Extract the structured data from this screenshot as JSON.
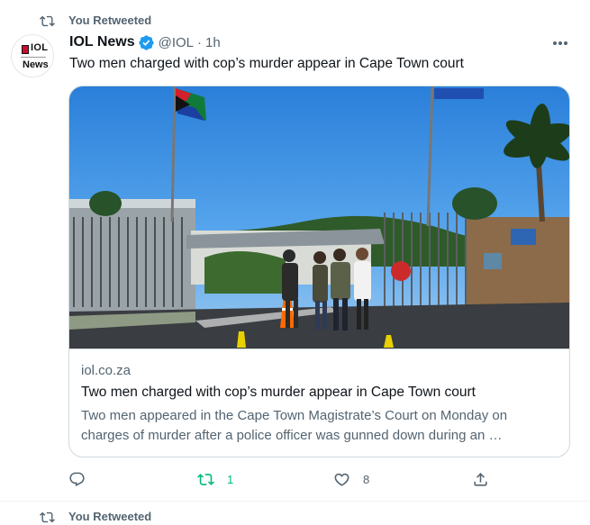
{
  "retweet_header": {
    "label": "You Retweeted"
  },
  "author": {
    "display_name": "IOL News",
    "handle": "@IOL",
    "separator": "·",
    "time_ago": "1h",
    "avatar_text": {
      "line1": "IOL",
      "line2": "News"
    },
    "verified": true
  },
  "tweet": {
    "text": "Two men charged with cop’s murder appear in Cape Town court"
  },
  "card": {
    "domain": "iol.co.za",
    "title": "Two men charged with cop’s murder appear in Cape Town court",
    "description": "Two men appeared in the Cape Town Magistrate’s Court on Monday on charges of murder after a police officer was gunned down during an …"
  },
  "actions": {
    "reply_count": "",
    "retweet_count": "1",
    "like_count": "8"
  },
  "colors": {
    "accent": "#1d9bf0",
    "retweet_green": "#00ba7c",
    "secondary_text": "#536471",
    "border": "#cfd9de"
  },
  "icons": {
    "retweet": "retweet-icon",
    "verified": "verified-badge-icon",
    "more": "more-dots-icon",
    "reply": "reply-bubble-icon",
    "like": "heart-icon",
    "share": "share-upload-icon"
  },
  "next_tweet": {
    "label": "You Retweeted"
  }
}
